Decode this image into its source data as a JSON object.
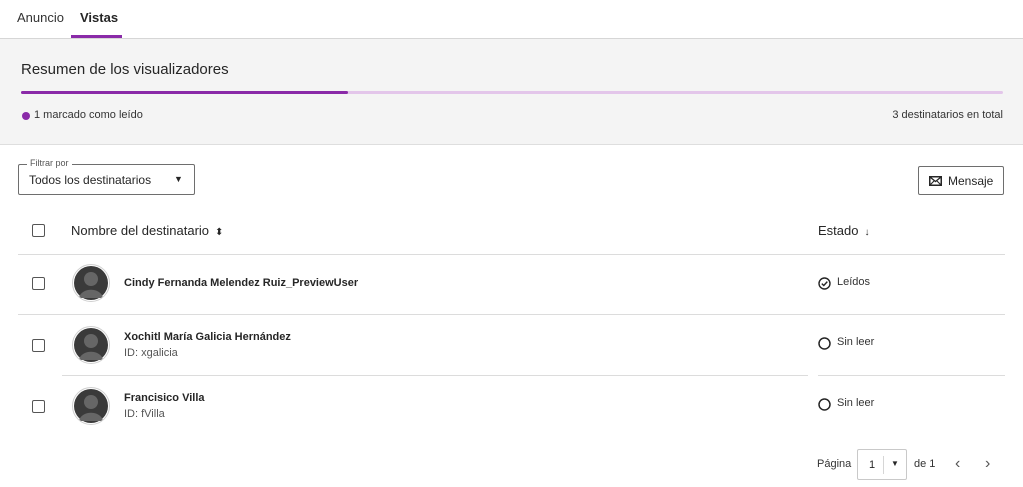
{
  "tabs": [
    {
      "label": "Anuncio",
      "active": false
    },
    {
      "label": "Vistas",
      "active": true
    }
  ],
  "summary": {
    "title": "Resumen de los visualizadores",
    "read_fraction": 0.333,
    "read_label": "1 marcado como leído",
    "total_label": "3 destinatarios en total"
  },
  "filter": {
    "legend": "Filtrar por",
    "value": "Todos los destinatarios"
  },
  "message_button": {
    "label": "Mensaje",
    "icon": "envelope-icon"
  },
  "table": {
    "headers": {
      "name": "Nombre del destinatario",
      "name_sort": "⬍",
      "status": "Estado",
      "status_sort": "↓"
    },
    "rows": [
      {
        "name": "Cindy Fernanda Melendez Ruiz_PreviewUser",
        "id": "",
        "status": "Leídos",
        "status_icon": "check-circle-icon"
      },
      {
        "name": "Xochitl María Galicia Hernández",
        "id": "ID: xgalicia",
        "status": "Sin leer",
        "status_icon": "empty-circle-icon"
      },
      {
        "name": "Francisico Villa",
        "id": "ID: fVilla",
        "status": "Sin leer",
        "status_icon": "empty-circle-icon"
      }
    ]
  },
  "pagination": {
    "page_label": "Página",
    "current_page": "1",
    "of_label": "de 1",
    "prev_icon": "‹",
    "next_icon": "›"
  },
  "colors": {
    "accent": "#8a2aa8",
    "accent_light": "#e3c6ea"
  }
}
